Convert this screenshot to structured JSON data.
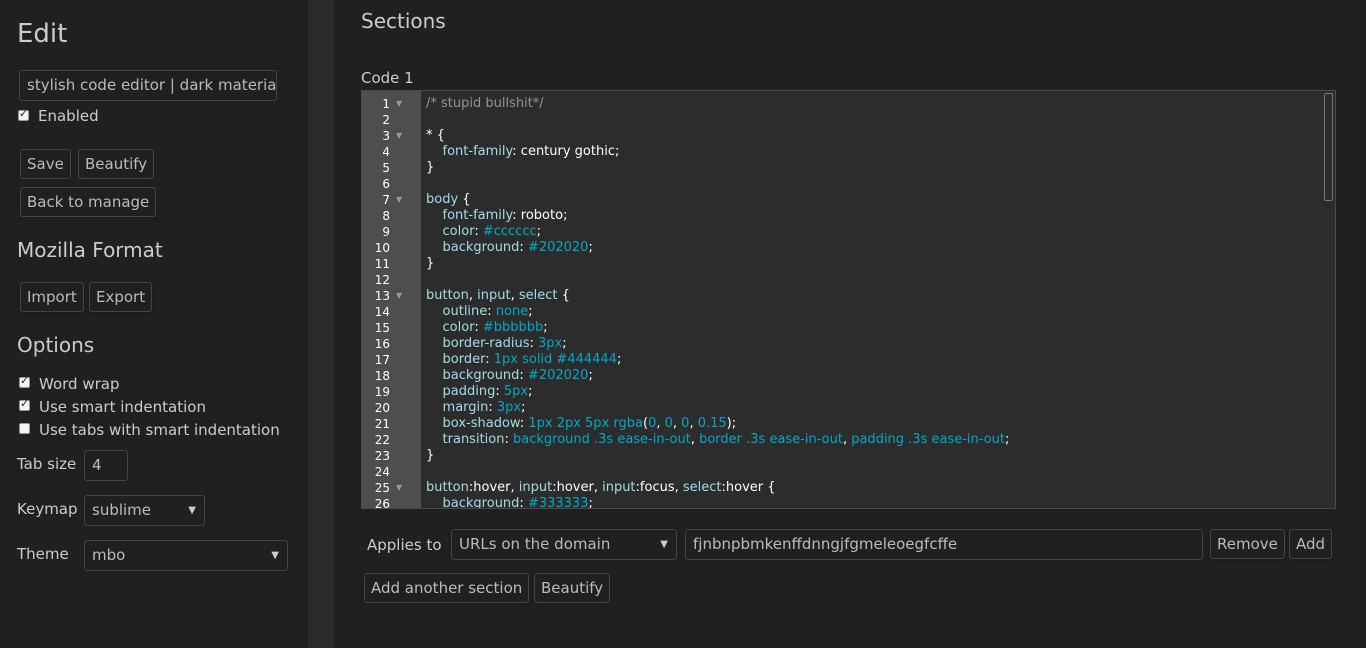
{
  "sidebar": {
    "title": "Edit",
    "style_name": "stylish code editor | dark material",
    "enabled_label": "Enabled",
    "enabled": true,
    "save_label": "Save",
    "beautify_label": "Beautify",
    "back_label": "Back to manage",
    "mozilla_heading": "Mozilla Format",
    "import_label": "Import",
    "export_label": "Export",
    "options_heading": "Options",
    "options": [
      {
        "label": "Word wrap",
        "checked": true
      },
      {
        "label": "Use smart indentation",
        "checked": true
      },
      {
        "label": "Use tabs with smart indentation",
        "checked": false
      }
    ],
    "tab_size_label": "Tab size",
    "tab_size_value": "4",
    "keymap_label": "Keymap",
    "keymap_value": "sublime",
    "theme_label": "Theme",
    "theme_value": "mbo"
  },
  "main": {
    "sections_heading": "Sections",
    "code_label": "Code 1",
    "applies_to_label": "Applies to",
    "applies_type": "URLs on the domain",
    "applies_value": "fjnbnpbmkenffdnngjfgmeleoegfcffe",
    "remove_label": "Remove",
    "add_label": "Add",
    "add_section_label": "Add another section",
    "beautify_label": "Beautify"
  },
  "colors": {
    "background": "#202020",
    "comment": "#95958a",
    "selector": "#9ddfe9",
    "property": "#9ddfe9",
    "value": "#00a8c6",
    "plain": "#ffffff",
    "gutter": "#4e4e4e"
  },
  "code_lines": [
    {
      "n": "1",
      "fold": true,
      "tokens": [
        [
          "comment",
          "/* stupid bullshit*/"
        ]
      ]
    },
    {
      "n": "2",
      "fold": false,
      "tokens": []
    },
    {
      "n": "3",
      "fold": true,
      "tokens": [
        [
          "plain",
          "* {"
        ]
      ]
    },
    {
      "n": "4",
      "fold": false,
      "tokens": [
        [
          "plain",
          "    "
        ],
        [
          "property",
          "font-family"
        ],
        [
          "plain",
          ": century gothic;"
        ]
      ]
    },
    {
      "n": "5",
      "fold": false,
      "tokens": [
        [
          "plain",
          "}"
        ]
      ]
    },
    {
      "n": "6",
      "fold": false,
      "tokens": []
    },
    {
      "n": "7",
      "fold": true,
      "tokens": [
        [
          "selector",
          "body"
        ],
        [
          "plain",
          " {"
        ]
      ]
    },
    {
      "n": "8",
      "fold": false,
      "tokens": [
        [
          "plain",
          "    "
        ],
        [
          "property",
          "font-family"
        ],
        [
          "plain",
          ": roboto;"
        ]
      ]
    },
    {
      "n": "9",
      "fold": false,
      "tokens": [
        [
          "plain",
          "    "
        ],
        [
          "property",
          "color"
        ],
        [
          "plain",
          ": "
        ],
        [
          "value",
          "#cccccc"
        ],
        [
          "plain",
          ";"
        ]
      ]
    },
    {
      "n": "10",
      "fold": false,
      "tokens": [
        [
          "plain",
          "    "
        ],
        [
          "property",
          "background"
        ],
        [
          "plain",
          ": "
        ],
        [
          "value",
          "#202020"
        ],
        [
          "plain",
          ";"
        ]
      ]
    },
    {
      "n": "11",
      "fold": false,
      "tokens": [
        [
          "plain",
          "}"
        ]
      ]
    },
    {
      "n": "12",
      "fold": false,
      "tokens": []
    },
    {
      "n": "13",
      "fold": true,
      "tokens": [
        [
          "selector",
          "button"
        ],
        [
          "plain",
          ", "
        ],
        [
          "selector",
          "input"
        ],
        [
          "plain",
          ", "
        ],
        [
          "selector",
          "select"
        ],
        [
          "plain",
          " {"
        ]
      ]
    },
    {
      "n": "14",
      "fold": false,
      "tokens": [
        [
          "plain",
          "    "
        ],
        [
          "property",
          "outline"
        ],
        [
          "plain",
          ": "
        ],
        [
          "value",
          "none"
        ],
        [
          "plain",
          ";"
        ]
      ]
    },
    {
      "n": "15",
      "fold": false,
      "tokens": [
        [
          "plain",
          "    "
        ],
        [
          "property",
          "color"
        ],
        [
          "plain",
          ": "
        ],
        [
          "value",
          "#bbbbbb"
        ],
        [
          "plain",
          ";"
        ]
      ]
    },
    {
      "n": "16",
      "fold": false,
      "tokens": [
        [
          "plain",
          "    "
        ],
        [
          "property",
          "border-radius"
        ],
        [
          "plain",
          ": "
        ],
        [
          "value",
          "3px"
        ],
        [
          "plain",
          ";"
        ]
      ]
    },
    {
      "n": "17",
      "fold": false,
      "tokens": [
        [
          "plain",
          "    "
        ],
        [
          "property",
          "border"
        ],
        [
          "plain",
          ": "
        ],
        [
          "value",
          "1px solid #444444"
        ],
        [
          "plain",
          ";"
        ]
      ]
    },
    {
      "n": "18",
      "fold": false,
      "tokens": [
        [
          "plain",
          "    "
        ],
        [
          "property",
          "background"
        ],
        [
          "plain",
          ": "
        ],
        [
          "value",
          "#202020"
        ],
        [
          "plain",
          ";"
        ]
      ]
    },
    {
      "n": "19",
      "fold": false,
      "tokens": [
        [
          "plain",
          "    "
        ],
        [
          "property",
          "padding"
        ],
        [
          "plain",
          ": "
        ],
        [
          "value",
          "5px"
        ],
        [
          "plain",
          ";"
        ]
      ]
    },
    {
      "n": "20",
      "fold": false,
      "tokens": [
        [
          "plain",
          "    "
        ],
        [
          "property",
          "margin"
        ],
        [
          "plain",
          ": "
        ],
        [
          "value",
          "3px"
        ],
        [
          "plain",
          ";"
        ]
      ]
    },
    {
      "n": "21",
      "fold": false,
      "tokens": [
        [
          "plain",
          "    "
        ],
        [
          "property",
          "box-shadow"
        ],
        [
          "plain",
          ": "
        ],
        [
          "value",
          "1px 2px 5px rgba"
        ],
        [
          "plain",
          "("
        ],
        [
          "value",
          "0"
        ],
        [
          "plain",
          ", "
        ],
        [
          "value",
          "0"
        ],
        [
          "plain",
          ", "
        ],
        [
          "value",
          "0"
        ],
        [
          "plain",
          ", "
        ],
        [
          "value",
          "0.15"
        ],
        [
          "plain",
          ");"
        ]
      ]
    },
    {
      "n": "22",
      "fold": false,
      "tokens": [
        [
          "plain",
          "    "
        ],
        [
          "property",
          "transition"
        ],
        [
          "plain",
          ": "
        ],
        [
          "value",
          "background .3s ease-in-out"
        ],
        [
          "plain",
          ", "
        ],
        [
          "value",
          "border .3s ease-in-out"
        ],
        [
          "plain",
          ", "
        ],
        [
          "value",
          "padding .3s ease-in-out"
        ],
        [
          "plain",
          ";"
        ]
      ]
    },
    {
      "n": "23",
      "fold": false,
      "tokens": [
        [
          "plain",
          "}"
        ]
      ]
    },
    {
      "n": "24",
      "fold": false,
      "tokens": []
    },
    {
      "n": "25",
      "fold": true,
      "tokens": [
        [
          "selector",
          "button"
        ],
        [
          "plain",
          ":hover, "
        ],
        [
          "selector",
          "input"
        ],
        [
          "plain",
          ":hover, "
        ],
        [
          "selector",
          "input"
        ],
        [
          "plain",
          ":focus, "
        ],
        [
          "selector",
          "select"
        ],
        [
          "plain",
          ":hover {"
        ]
      ]
    },
    {
      "n": "26",
      "fold": false,
      "tokens": [
        [
          "plain",
          "    "
        ],
        [
          "property",
          "background"
        ],
        [
          "plain",
          ": "
        ],
        [
          "value",
          "#333333"
        ],
        [
          "plain",
          ";"
        ]
      ]
    }
  ]
}
